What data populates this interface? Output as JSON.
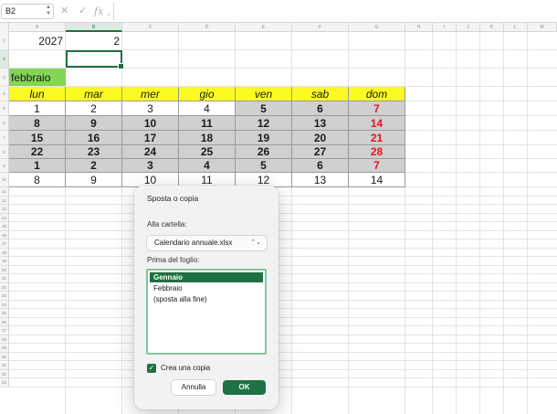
{
  "formula_bar": {
    "cell_ref": "B2",
    "cancel_icon": "x-icon",
    "confirm_icon": "check-icon",
    "function_label": "fx",
    "value": ""
  },
  "grid": {
    "columns": [
      "A",
      "B",
      "C",
      "D",
      "E",
      "F",
      "G",
      "H",
      "I",
      "J",
      "K",
      "L",
      "M"
    ],
    "active_column": "B",
    "rows": [
      "1",
      "2",
      "3",
      "4",
      "5",
      "6",
      "7",
      "8",
      "9",
      "10",
      "11",
      "12",
      "13",
      "14",
      "15",
      "16",
      "17",
      "18",
      "19",
      "20",
      "21",
      "22",
      "23",
      "24",
      "25",
      "26",
      "27",
      "28",
      "29",
      "30",
      "31",
      "32",
      "33"
    ],
    "active_row": "2",
    "year": "2027",
    "month_number": "2",
    "month_name": "febbraio",
    "weekdays": [
      "lun",
      "mar",
      "mer",
      "gio",
      "ven",
      "sab",
      "dom"
    ],
    "weeks": [
      [
        "1",
        "2",
        "3",
        "4",
        "5",
        "6",
        "7"
      ],
      [
        "8",
        "9",
        "10",
        "11",
        "12",
        "13",
        "14"
      ],
      [
        "15",
        "16",
        "17",
        "18",
        "19",
        "20",
        "21"
      ],
      [
        "22",
        "23",
        "24",
        "25",
        "26",
        "27",
        "28"
      ],
      [
        "1",
        "2",
        "3",
        "4",
        "5",
        "6",
        "7"
      ],
      [
        "8",
        "9",
        "10",
        "11",
        "12",
        "13",
        "14"
      ]
    ],
    "colors": {
      "weekday_header": "#fbfb23",
      "month_label": "#84d458",
      "weekend_gray": "#d0d0d0",
      "sunday_red": "#e8141c",
      "selection": "#1e7145"
    }
  },
  "dialog": {
    "title": "Sposta o copia",
    "to_book_label": "Alla cartella:",
    "to_book_value": "Calendario annuale.xlsx",
    "before_sheet_label": "Prima del foglio:",
    "sheets": [
      "Gennaio",
      "Febbraio",
      "(sposta alla fine)"
    ],
    "selected_sheet": "Gennaio",
    "create_copy_label": "Crea una copia",
    "create_copy_checked": true,
    "cancel_label": "Annulla",
    "ok_label": "OK"
  }
}
